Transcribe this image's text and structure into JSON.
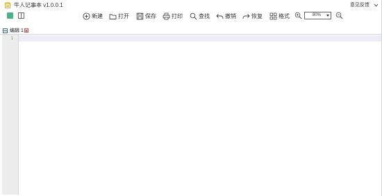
{
  "window": {
    "title": "牛人记事本 v1.0.0.1",
    "feedback_label": "意见反馈"
  },
  "toolbar": {
    "new_label": "新建",
    "open_label": "打开",
    "save_label": "保存",
    "print_label": "打印",
    "find_label": "查找",
    "undo_label": "撤销",
    "redo_label": "恢复",
    "format_label": "格式",
    "zoom_value": "80%"
  },
  "tabs": [
    {
      "label": "编辑 1"
    }
  ],
  "editor": {
    "line_numbers": [
      "1"
    ],
    "current_line_color": "#ececf7"
  },
  "colors": {
    "accent_green": "#48b383",
    "tab_icon_blue": "#3a6ea5",
    "close_red": "#d9534f"
  },
  "icons": {
    "logo": "notepad-icon",
    "menu": "chevron-down-icon",
    "new": "plus-circle-icon",
    "open": "folder-icon",
    "save": "floppy-disk-icon",
    "print": "printer-icon",
    "find": "search-icon",
    "undo": "undo-arrow-icon",
    "redo": "redo-arrow-icon",
    "format": "grid-icon",
    "zoom_in": "zoom-in-icon",
    "zoom_out": "zoom-out-icon"
  }
}
